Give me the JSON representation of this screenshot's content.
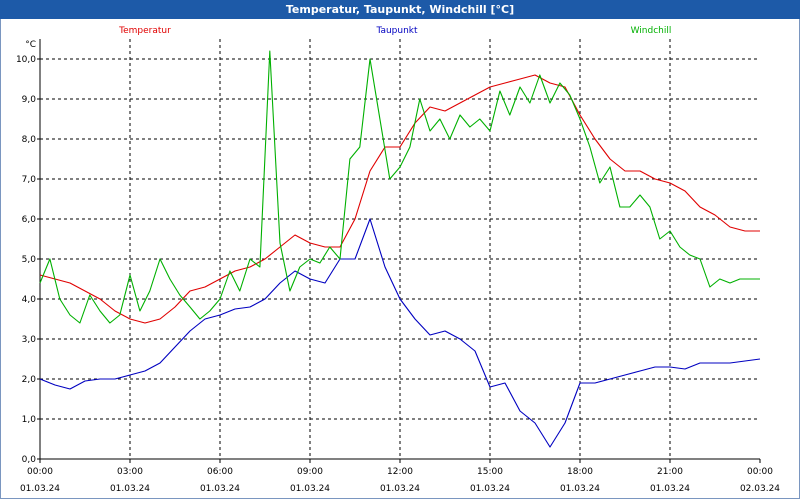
{
  "window": {
    "title": "Temperatur, Taupunkt, Windchill [°C]"
  },
  "chart_data": {
    "type": "line",
    "title": "Temperatur, Taupunkt, Windchill [°C]",
    "ylabel": "°C",
    "ylim": [
      0,
      10.5
    ],
    "xlim": [
      0,
      24
    ],
    "grid": true,
    "legend_position": "top",
    "y_ticks": [
      "0,0",
      "1,0",
      "2,0",
      "3,0",
      "4,0",
      "5,0",
      "6,0",
      "7,0",
      "8,0",
      "9,0",
      "10,0"
    ],
    "x_ticks": [
      {
        "time": "00:00",
        "date": "01.03.24"
      },
      {
        "time": "03:00",
        "date": "01.03.24"
      },
      {
        "time": "06:00",
        "date": "01.03.24"
      },
      {
        "time": "09:00",
        "date": "01.03.24"
      },
      {
        "time": "12:00",
        "date": "01.03.24"
      },
      {
        "time": "15:00",
        "date": "01.03.24"
      },
      {
        "time": "18:00",
        "date": "01.03.24"
      },
      {
        "time": "21:00",
        "date": "01.03.24"
      },
      {
        "time": "00:00",
        "date": "02.03.24"
      }
    ],
    "series": [
      {
        "name": "Temperatur",
        "color": "#e00000",
        "points": [
          [
            0,
            4.6
          ],
          [
            0.5,
            4.5
          ],
          [
            1,
            4.4
          ],
          [
            1.5,
            4.2
          ],
          [
            2,
            4.0
          ],
          [
            2.5,
            3.7
          ],
          [
            3,
            3.5
          ],
          [
            3.5,
            3.4
          ],
          [
            4,
            3.5
          ],
          [
            4.5,
            3.8
          ],
          [
            5,
            4.2
          ],
          [
            5.5,
            4.3
          ],
          [
            6,
            4.5
          ],
          [
            6.5,
            4.7
          ],
          [
            7,
            4.8
          ],
          [
            7.5,
            5.0
          ],
          [
            8,
            5.3
          ],
          [
            8.5,
            5.6
          ],
          [
            9,
            5.4
          ],
          [
            9.5,
            5.3
          ],
          [
            10,
            5.3
          ],
          [
            10.5,
            6.0
          ],
          [
            11,
            7.2
          ],
          [
            11.5,
            7.8
          ],
          [
            12,
            7.8
          ],
          [
            12.5,
            8.4
          ],
          [
            13,
            8.8
          ],
          [
            13.5,
            8.7
          ],
          [
            14,
            8.9
          ],
          [
            14.5,
            9.1
          ],
          [
            15,
            9.3
          ],
          [
            15.5,
            9.4
          ],
          [
            16,
            9.5
          ],
          [
            16.5,
            9.6
          ],
          [
            17,
            9.4
          ],
          [
            17.5,
            9.3
          ],
          [
            18,
            8.6
          ],
          [
            18.5,
            8.0
          ],
          [
            19,
            7.5
          ],
          [
            19.5,
            7.2
          ],
          [
            20,
            7.2
          ],
          [
            20.5,
            7.0
          ],
          [
            21,
            6.9
          ],
          [
            21.5,
            6.7
          ],
          [
            22,
            6.3
          ],
          [
            22.5,
            6.1
          ],
          [
            23,
            5.8
          ],
          [
            23.5,
            5.7
          ],
          [
            24,
            5.7
          ]
        ]
      },
      {
        "name": "Taupunkt",
        "color": "#0000c0",
        "points": [
          [
            0,
            2.0
          ],
          [
            0.5,
            1.85
          ],
          [
            1,
            1.75
          ],
          [
            1.5,
            1.95
          ],
          [
            2,
            2.0
          ],
          [
            2.5,
            2.0
          ],
          [
            3,
            2.1
          ],
          [
            3.5,
            2.2
          ],
          [
            4,
            2.4
          ],
          [
            4.5,
            2.8
          ],
          [
            5,
            3.2
          ],
          [
            5.5,
            3.5
          ],
          [
            6,
            3.6
          ],
          [
            6.5,
            3.75
          ],
          [
            7,
            3.8
          ],
          [
            7.5,
            4.0
          ],
          [
            8,
            4.4
          ],
          [
            8.5,
            4.7
          ],
          [
            9,
            4.5
          ],
          [
            9.5,
            4.4
          ],
          [
            10,
            5.0
          ],
          [
            10.5,
            5.0
          ],
          [
            11,
            6.0
          ],
          [
            11.5,
            4.8
          ],
          [
            12,
            4.0
          ],
          [
            12.5,
            3.5
          ],
          [
            13,
            3.1
          ],
          [
            13.5,
            3.2
          ],
          [
            14,
            3.0
          ],
          [
            14.5,
            2.7
          ],
          [
            15,
            1.8
          ],
          [
            15.5,
            1.9
          ],
          [
            16,
            1.2
          ],
          [
            16.5,
            0.9
          ],
          [
            17,
            0.3
          ],
          [
            17.5,
            0.9
          ],
          [
            18,
            1.9
          ],
          [
            18.5,
            1.9
          ],
          [
            19,
            2.0
          ],
          [
            19.5,
            2.1
          ],
          [
            20,
            2.2
          ],
          [
            20.5,
            2.3
          ],
          [
            21,
            2.3
          ],
          [
            21.5,
            2.25
          ],
          [
            22,
            2.4
          ],
          [
            22.5,
            2.4
          ],
          [
            23,
            2.4
          ],
          [
            23.5,
            2.45
          ],
          [
            24,
            2.5
          ]
        ]
      },
      {
        "name": "Windchill",
        "color": "#00b000",
        "points": [
          [
            0,
            4.4
          ],
          [
            0.33,
            5.0
          ],
          [
            0.66,
            4.0
          ],
          [
            1,
            3.6
          ],
          [
            1.33,
            3.4
          ],
          [
            1.66,
            4.1
          ],
          [
            2,
            3.7
          ],
          [
            2.33,
            3.4
          ],
          [
            2.66,
            3.6
          ],
          [
            3,
            4.6
          ],
          [
            3.33,
            3.7
          ],
          [
            3.66,
            4.2
          ],
          [
            4,
            5.0
          ],
          [
            4.33,
            4.5
          ],
          [
            4.66,
            4.1
          ],
          [
            5,
            3.8
          ],
          [
            5.33,
            3.5
          ],
          [
            5.66,
            3.7
          ],
          [
            6,
            4.0
          ],
          [
            6.33,
            4.7
          ],
          [
            6.66,
            4.2
          ],
          [
            7,
            5.0
          ],
          [
            7.33,
            4.8
          ],
          [
            7.66,
            10.2
          ],
          [
            8,
            5.4
          ],
          [
            8.33,
            4.2
          ],
          [
            8.66,
            4.8
          ],
          [
            9,
            5.0
          ],
          [
            9.33,
            4.9
          ],
          [
            9.66,
            5.3
          ],
          [
            10,
            5.0
          ],
          [
            10.33,
            7.5
          ],
          [
            10.66,
            7.8
          ],
          [
            11,
            10.0
          ],
          [
            11.33,
            8.5
          ],
          [
            11.66,
            7.0
          ],
          [
            12,
            7.3
          ],
          [
            12.33,
            7.8
          ],
          [
            12.66,
            9.0
          ],
          [
            13,
            8.2
          ],
          [
            13.33,
            8.5
          ],
          [
            13.66,
            8.0
          ],
          [
            14,
            8.6
          ],
          [
            14.33,
            8.3
          ],
          [
            14.66,
            8.5
          ],
          [
            15,
            8.2
          ],
          [
            15.33,
            9.2
          ],
          [
            15.66,
            8.6
          ],
          [
            16,
            9.3
          ],
          [
            16.33,
            8.9
          ],
          [
            16.66,
            9.6
          ],
          [
            17,
            8.9
          ],
          [
            17.33,
            9.4
          ],
          [
            17.66,
            9.1
          ],
          [
            18,
            8.5
          ],
          [
            18.33,
            7.8
          ],
          [
            18.66,
            6.9
          ],
          [
            19,
            7.3
          ],
          [
            19.33,
            6.3
          ],
          [
            19.66,
            6.3
          ],
          [
            20,
            6.6
          ],
          [
            20.33,
            6.3
          ],
          [
            20.66,
            5.5
          ],
          [
            21,
            5.7
          ],
          [
            21.33,
            5.3
          ],
          [
            21.66,
            5.1
          ],
          [
            22,
            5.0
          ],
          [
            22.33,
            4.3
          ],
          [
            22.66,
            4.5
          ],
          [
            23,
            4.4
          ],
          [
            23.33,
            4.5
          ],
          [
            23.66,
            4.5
          ],
          [
            24,
            4.5
          ]
        ]
      }
    ]
  }
}
